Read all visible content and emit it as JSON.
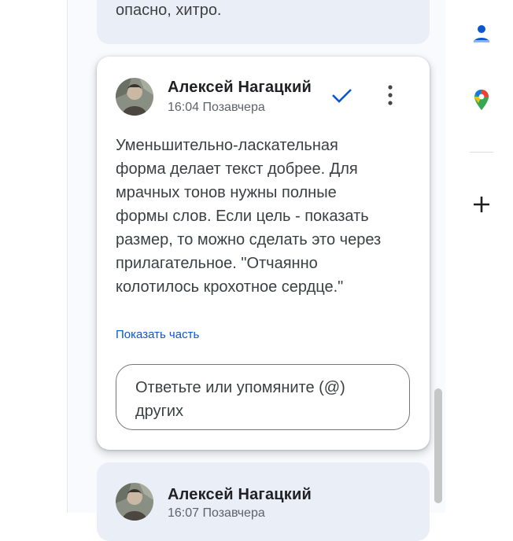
{
  "previous_comment": {
    "text": "опасно, хитро."
  },
  "comment": {
    "author": "Алексей Нагацкий",
    "time": "16:04 Позавчера",
    "body": "Уменьшительно-ласкательная форма делает текст добрее. Для мрачных тонов нужны полные формы слов. Если цель - показать размер, то можно сделать это через прилагательное. \"Отчаянно колотилось крохотное сердце.\"",
    "show_part_label": "Показать часть",
    "reply_placeholder": "Ответьте или упомяните (@) других",
    "icons": [
      "checkmark-icon",
      "more-vert-icon"
    ]
  },
  "next_comment": {
    "author": "Алексей Нагацкий",
    "time": "16:07 Позавчера"
  },
  "side_rail": {
    "icons": [
      "contacts-icon",
      "maps-icon",
      "plus-icon"
    ]
  },
  "colors": {
    "accent": "#0b57d0",
    "card_bg": "#eaeff7",
    "maps_red": "#ea4335",
    "maps_green": "#34a853",
    "maps_yellow": "#fbbc04"
  }
}
